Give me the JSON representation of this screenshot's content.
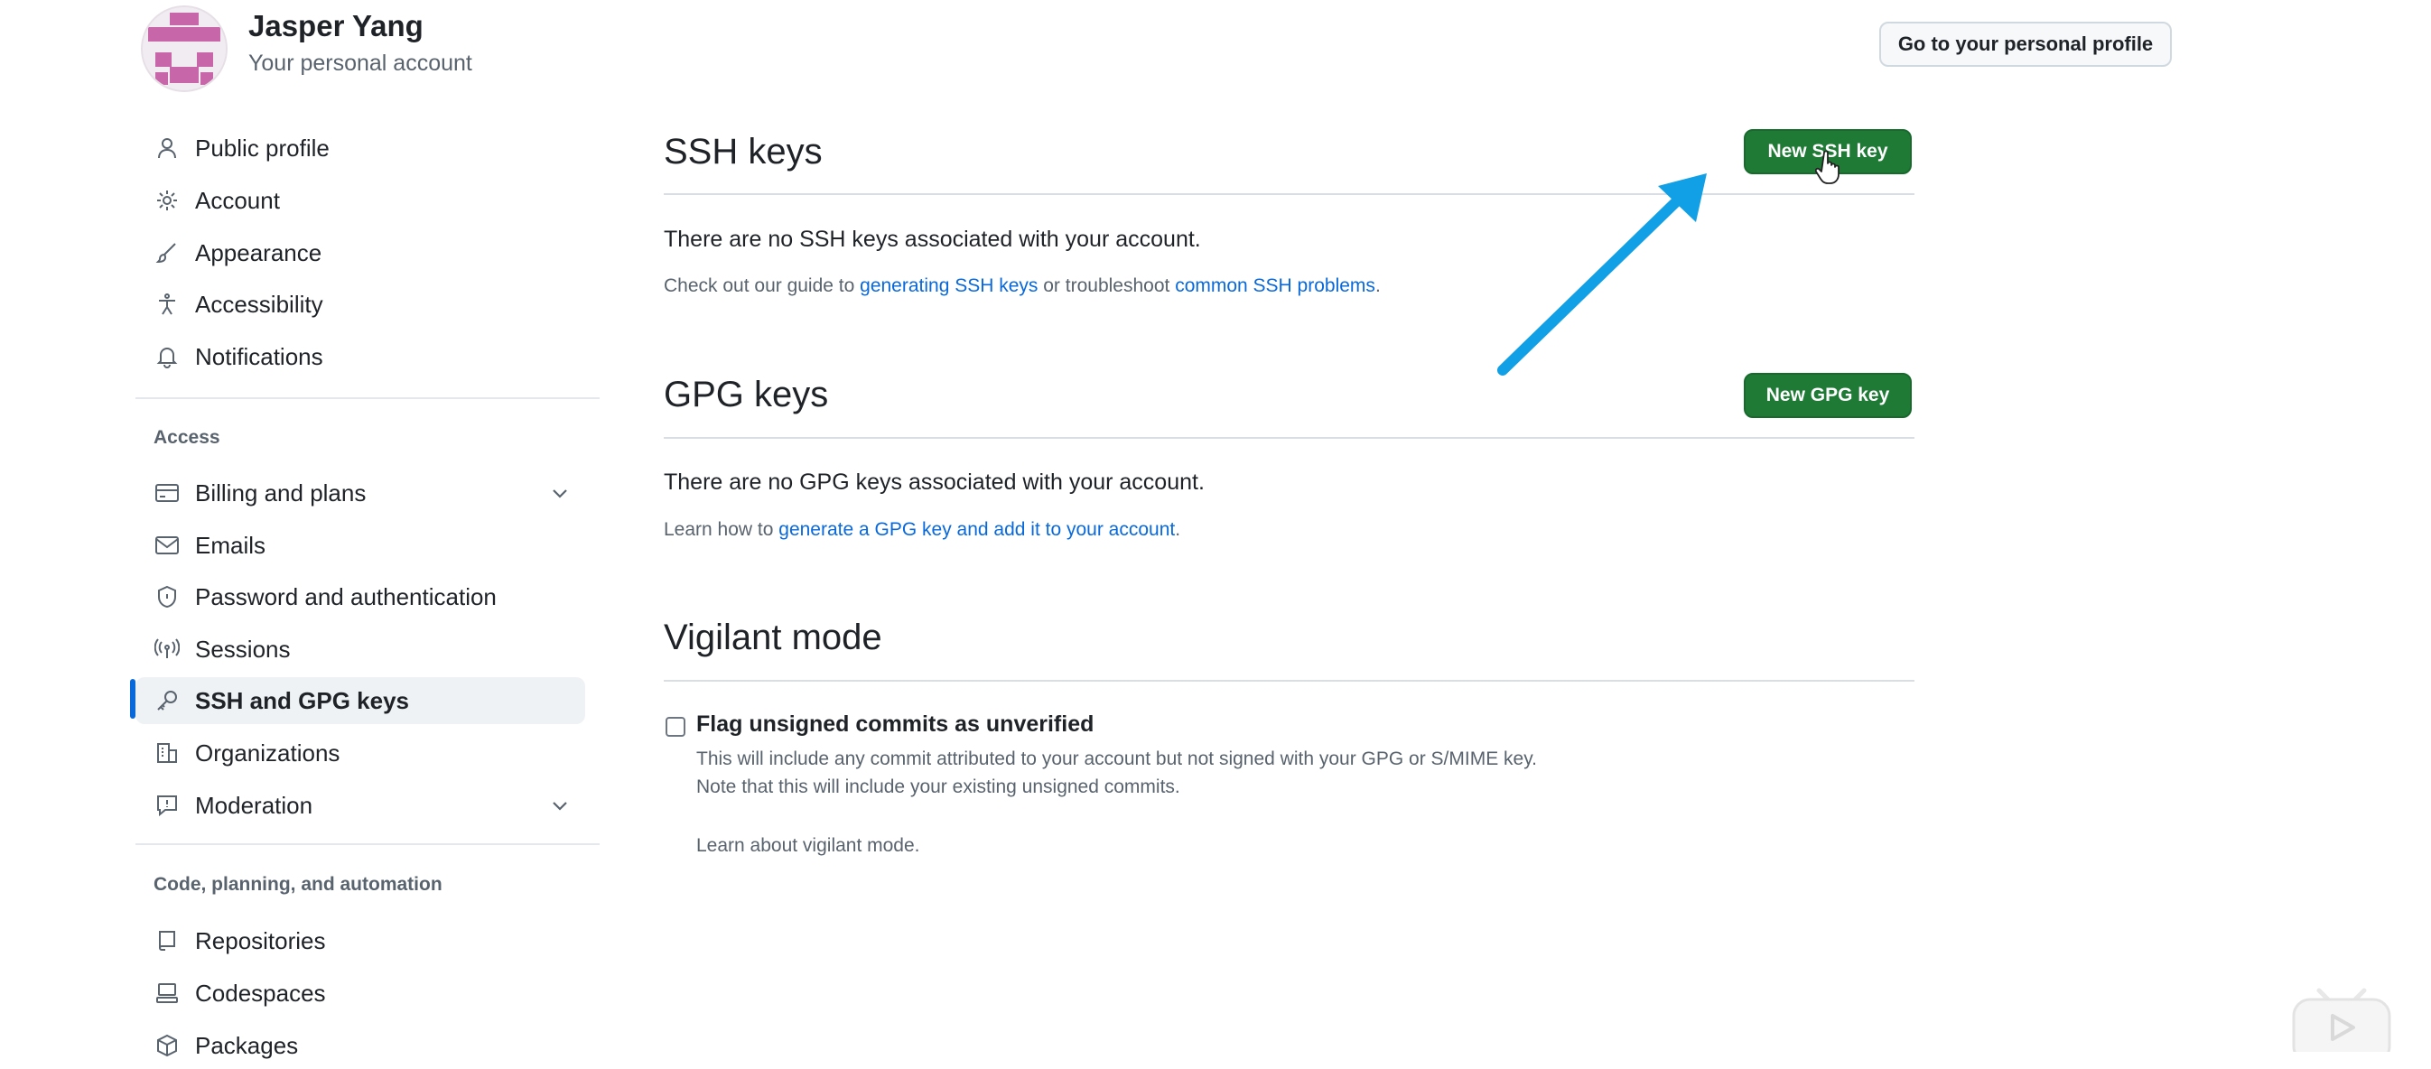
{
  "header": {
    "user_name": "Jasper Yang",
    "account_type": "Your personal account",
    "profile_button": "Go to your personal profile"
  },
  "sidebar": {
    "items_top": [
      {
        "label": "Public profile",
        "icon": "person-icon"
      },
      {
        "label": "Account",
        "icon": "gear-icon"
      },
      {
        "label": "Appearance",
        "icon": "paintbrush-icon"
      },
      {
        "label": "Accessibility",
        "icon": "accessibility-icon"
      },
      {
        "label": "Notifications",
        "icon": "bell-icon"
      }
    ],
    "access_heading": "Access",
    "items_access": [
      {
        "label": "Billing and plans",
        "icon": "credit-card-icon",
        "expandable": true
      },
      {
        "label": "Emails",
        "icon": "mail-icon"
      },
      {
        "label": "Password and authentication",
        "icon": "shield-lock-icon"
      },
      {
        "label": "Sessions",
        "icon": "broadcast-icon"
      },
      {
        "label": "SSH and GPG keys",
        "icon": "key-icon",
        "active": true
      },
      {
        "label": "Organizations",
        "icon": "organization-icon"
      },
      {
        "label": "Moderation",
        "icon": "report-icon",
        "expandable": true
      }
    ],
    "code_heading": "Code, planning, and automation",
    "items_code": [
      {
        "label": "Repositories",
        "icon": "repo-icon"
      },
      {
        "label": "Codespaces",
        "icon": "codespaces-icon"
      },
      {
        "label": "Packages",
        "icon": "package-icon"
      }
    ]
  },
  "ssh": {
    "title": "SSH keys",
    "new_button": "New SSH key",
    "empty_text": "There are no SSH keys associated with your account.",
    "help_prefix": "Check out our guide to ",
    "help_link1": "generating SSH keys",
    "help_middle": " or troubleshoot ",
    "help_link2": "common SSH problems",
    "help_suffix": "."
  },
  "gpg": {
    "title": "GPG keys",
    "new_button": "New GPG key",
    "empty_text": "There are no GPG keys associated with your account.",
    "help_prefix": "Learn how to ",
    "help_link": "generate a GPG key and add it to your account",
    "help_suffix": "."
  },
  "vigilant": {
    "title": "Vigilant mode",
    "checkbox_label": "Flag unsigned commits as unverified",
    "checked": false,
    "desc_line1": "This will include any commit attributed to your account but not signed with your GPG or S/MIME key.",
    "desc_line2": "Note that this will include your existing unsigned commits.",
    "learn_link": "Learn about vigilant mode."
  },
  "colors": {
    "accent_blue": "#0969da",
    "button_green": "#1f7a36",
    "annotation_arrow": "#119fe5"
  }
}
